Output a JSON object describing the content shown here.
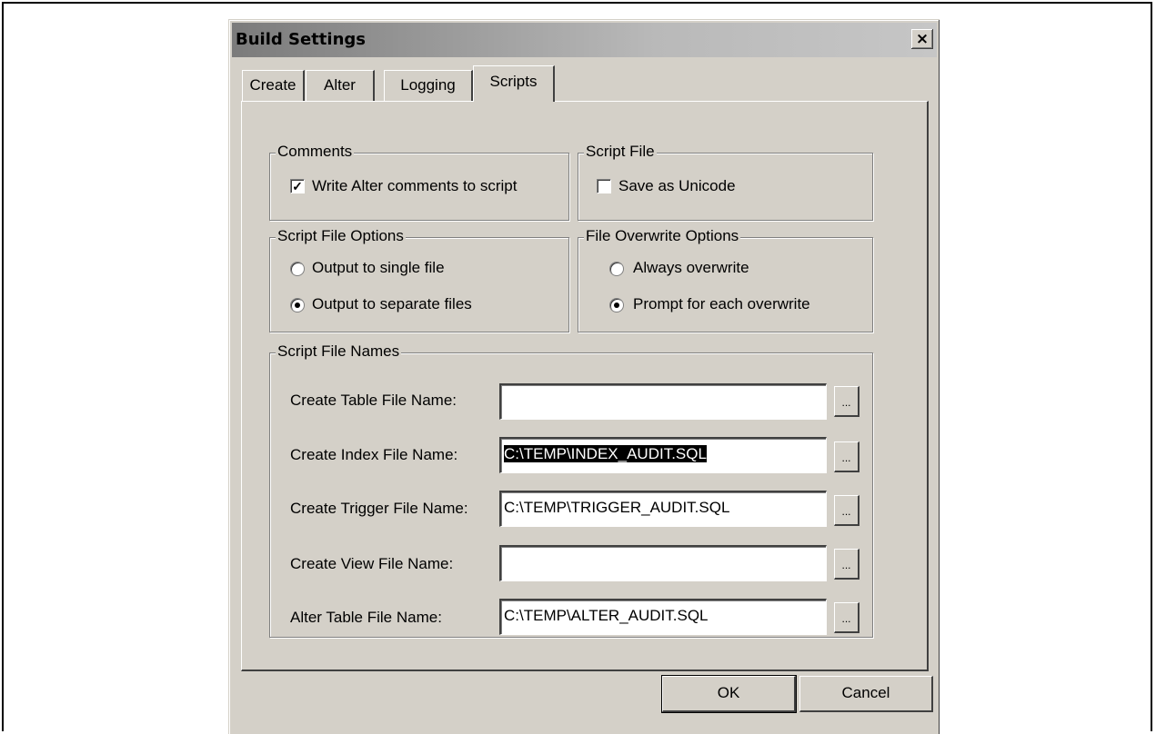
{
  "window": {
    "title": "Build Settings",
    "close_label": "×"
  },
  "tabs": [
    "Create",
    "Alter",
    "Logging",
    "Scripts"
  ],
  "comments": {
    "legend": "Comments",
    "checkbox_label": "Write Alter comments to script",
    "checked": true
  },
  "script_file": {
    "legend": "Script File",
    "checkbox_label": "Save as Unicode",
    "checked": false
  },
  "script_file_options": {
    "legend": "Script File Options",
    "options": [
      "Output to single file",
      "Output to separate files"
    ],
    "selected_index": 1
  },
  "file_overwrite_options": {
    "legend": "File Overwrite Options",
    "options": [
      "Always overwrite",
      "Prompt for each overwrite"
    ],
    "selected_index": 1
  },
  "script_file_names": {
    "legend": "Script File Names",
    "browse_label": "...",
    "rows": [
      {
        "label": "Create Table File Name:",
        "value": ""
      },
      {
        "label": "Create Index File Name:",
        "value": "C:\\TEMP\\INDEX_AUDIT.SQL"
      },
      {
        "label": "Create Trigger File Name:",
        "value": "C:\\TEMP\\TRIGGER_AUDIT.SQL"
      },
      {
        "label": "Create View File Name:",
        "value": ""
      },
      {
        "label": "Alter Table File Name:",
        "value": "C:\\TEMP\\ALTER_AUDIT.SQL"
      }
    ]
  },
  "buttons": {
    "ok": "OK",
    "cancel": "Cancel"
  }
}
